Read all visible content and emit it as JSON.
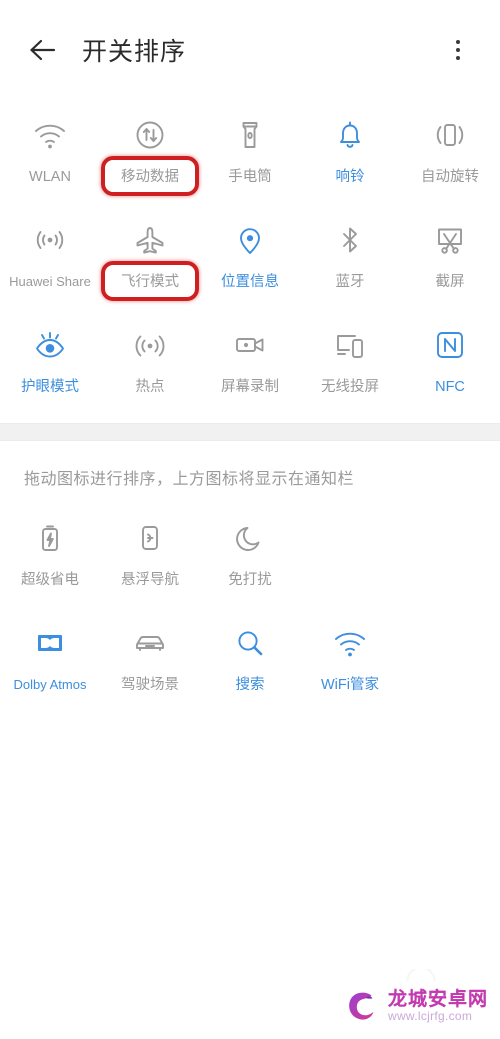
{
  "header": {
    "back_icon": "arrow-left-icon",
    "title": "开关排序",
    "menu_icon": "kebab-menu-icon"
  },
  "top_section": {
    "rows": [
      [
        {
          "label": "WLAN",
          "icon": "wifi-icon",
          "active": false,
          "annotated": false
        },
        {
          "label": "移动数据",
          "icon": "mobile-data-icon",
          "active": false,
          "annotated": true
        },
        {
          "label": "手电筒",
          "icon": "flashlight-icon",
          "active": false,
          "annotated": false
        },
        {
          "label": "响铃",
          "icon": "bell-icon",
          "active": true,
          "annotated": false
        },
        {
          "label": "自动旋转",
          "icon": "auto-rotate-icon",
          "active": false,
          "annotated": false
        }
      ],
      [
        {
          "label": "Huawei Share",
          "icon": "huawei-share-icon",
          "active": false,
          "annotated": false
        },
        {
          "label": "飞行模式",
          "icon": "airplane-icon",
          "active": false,
          "annotated": true
        },
        {
          "label": "位置信息",
          "icon": "location-pin-icon",
          "active": true,
          "annotated": false
        },
        {
          "label": "蓝牙",
          "icon": "bluetooth-icon",
          "active": false,
          "annotated": false
        },
        {
          "label": "截屏",
          "icon": "screenshot-icon",
          "active": false,
          "annotated": false
        }
      ],
      [
        {
          "label": "护眼模式",
          "icon": "eye-comfort-icon",
          "active": true,
          "annotated": false
        },
        {
          "label": "热点",
          "icon": "hotspot-icon",
          "active": false,
          "annotated": false
        },
        {
          "label": "屏幕录制",
          "icon": "screen-record-icon",
          "active": false,
          "annotated": false
        },
        {
          "label": "无线投屏",
          "icon": "wireless-cast-icon",
          "active": false,
          "annotated": false
        },
        {
          "label": "NFC",
          "icon": "nfc-icon",
          "active": true,
          "annotated": false
        }
      ]
    ]
  },
  "hint": "拖动图标进行排序，上方图标将显示在通知栏",
  "bottom_section": {
    "rows": [
      [
        {
          "label": "超级省电",
          "icon": "battery-saver-icon",
          "active": false
        },
        {
          "label": "悬浮导航",
          "icon": "floating-nav-icon",
          "active": false
        },
        {
          "label": "免打扰",
          "icon": "moon-icon",
          "active": false
        }
      ],
      [
        {
          "label": "Dolby Atmos",
          "icon": "dolby-atmos-icon",
          "active": true
        },
        {
          "label": "驾驶场景",
          "icon": "car-icon",
          "active": false
        },
        {
          "label": "搜索",
          "icon": "search-icon",
          "active": true
        },
        {
          "label": "WiFi管家",
          "icon": "wifi-manager-icon",
          "active": true
        }
      ]
    ]
  },
  "watermark": {
    "title": "龙城安卓网",
    "url": "www.lcjrfg.com",
    "logo_icon": "dragon-logo-icon"
  },
  "colors": {
    "accent_blue": "#3c8ede",
    "inactive_gray": "#9a9a9a",
    "annotation_red": "#cf1f21",
    "band_gray": "#f1f1f1"
  }
}
